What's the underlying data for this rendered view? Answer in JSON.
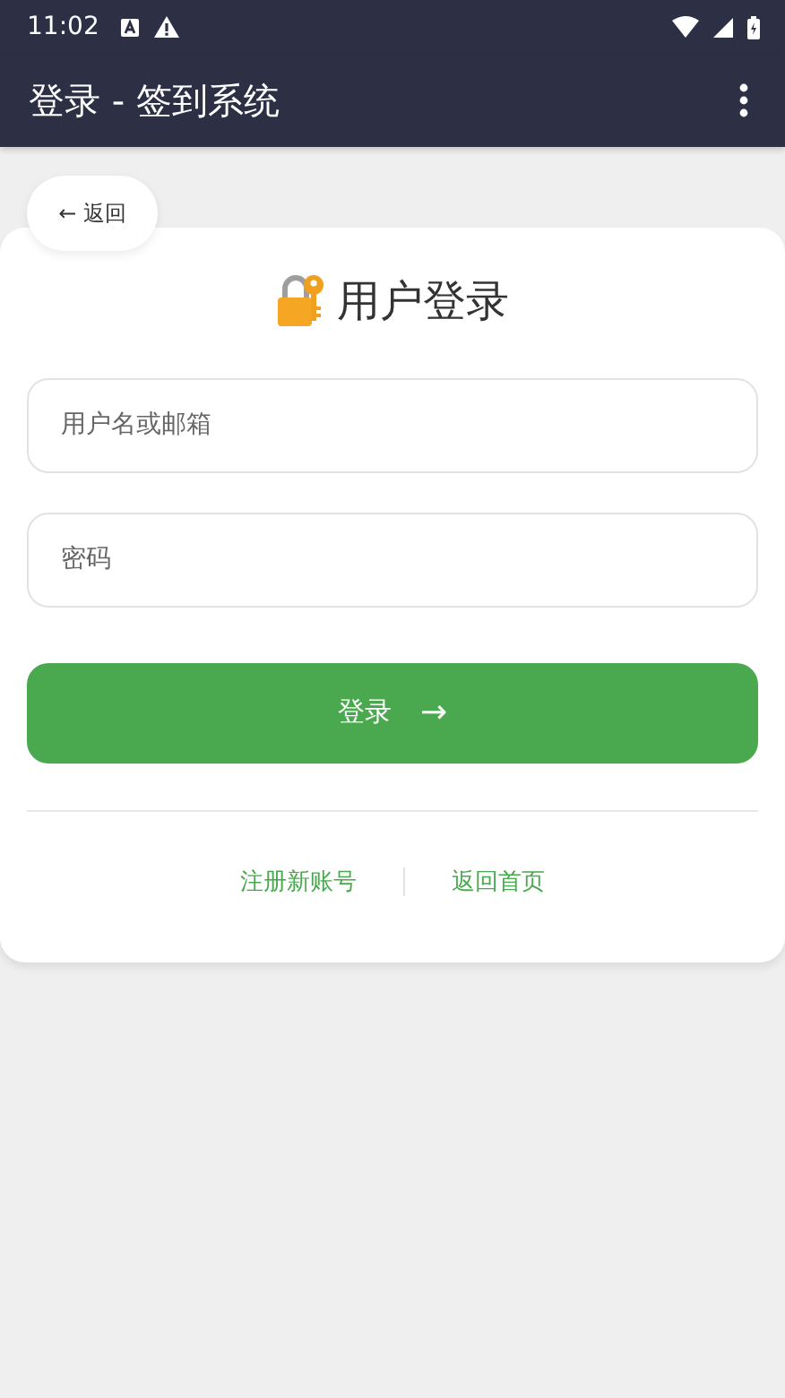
{
  "status_bar": {
    "time": "11:02"
  },
  "app_bar": {
    "title": "登录 - 签到系统"
  },
  "back_button": {
    "label": "← 返回"
  },
  "heading": "用户登录",
  "fields": [
    {
      "placeholder": "用户名或邮箱"
    },
    {
      "placeholder": "密码"
    }
  ],
  "login_button": {
    "label": "登录",
    "arrow": "→"
  },
  "links": [
    "注册新账号",
    "返回首页"
  ]
}
